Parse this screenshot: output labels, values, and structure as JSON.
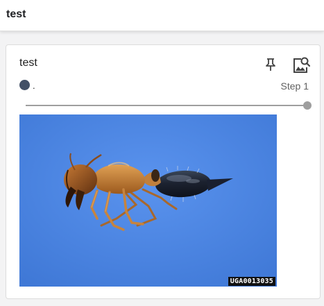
{
  "header": {
    "title": "test"
  },
  "card": {
    "title": "test",
    "pin_icon": "pin-icon",
    "image_search_icon": "image-search-icon",
    "run": {
      "name": ".",
      "color": "#425066"
    },
    "step_label": "Step 1",
    "slider": {
      "value_fraction": 1.0
    },
    "image": {
      "subject": "ant",
      "background_color": "#4a83e0",
      "watermark": "UGA0013035"
    }
  }
}
